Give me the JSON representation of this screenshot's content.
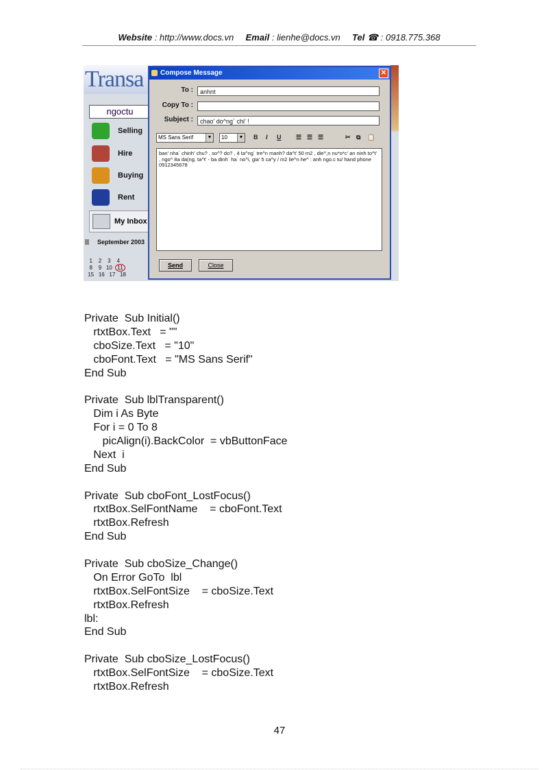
{
  "header": {
    "website_label": "Website",
    "website_value": ": http://www.docs.vn",
    "email_label": "Email",
    "email_value": ": lienhe@docs.vn",
    "tel_label": "Tel",
    "tel_icon": "phone-icon",
    "tel_value": ": 0918.775.368"
  },
  "screenshot": {
    "banner": "Transa",
    "user": "ngoctu",
    "nav": [
      {
        "label": "Selling",
        "icon": "selling-icon",
        "color": "#2fa52f"
      },
      {
        "label": "Hire",
        "icon": "house-icon",
        "color": "#b0463a"
      },
      {
        "label": "Buying",
        "icon": "people-icon",
        "color": "#d9901c"
      },
      {
        "label": "Rent",
        "icon": "book-icon",
        "color": "#1f3d9a"
      }
    ],
    "inbox_label": "My Inbox",
    "month": "September 2003",
    "calendar": [
      [
        "1",
        "2",
        "3",
        "4"
      ],
      [
        "8",
        "9",
        "10",
        "11"
      ],
      [
        "15",
        "16",
        "17",
        "18"
      ]
    ],
    "dialog": {
      "title": "Compose Message",
      "to_label": "To :",
      "to_value": "anhnt",
      "copy_label": "Copy To :",
      "copy_value": "",
      "subject_label": "Subject :",
      "subject_value": "chao' do^ng` chi' !",
      "font_value": "MS Sans Serif",
      "size_value": "10",
      "bold": "B",
      "italic": "I",
      "underline": "U",
      "body_text": "ban' nha` chinh' chu? , so^? do? , 4 ta^ng` tre^n manh? da^t' 50 m2 , die^,n nu*o*c' an ninh to^t' , ngo^ 8a da(ng. ta^t' - ba dinh` ha` no^i, gia' 5 ca^y / m2 lie^n he^ : anh ngo.c tu/ hand phone 0912345678",
      "send": "Send",
      "close": "Close"
    }
  },
  "code_lines": [
    "Private  Sub Initial()",
    "   rtxtBox.Text   = \"\"",
    "   cboSize.Text   = \"10\"",
    "   cboFont.Text   = \"MS Sans Serif\"",
    "End Sub",
    "",
    "Private  Sub lblTransparent()",
    "   Dim i As Byte",
    "   For i = 0 To 8",
    "      picAlign(i).BackColor  = vbButtonFace",
    "   Next  i",
    "End Sub",
    "",
    "Private  Sub cboFont_LostFocus()",
    "   rtxtBox.SelFontName    = cboFont.Text",
    "   rtxtBox.Refresh",
    "End Sub",
    "",
    "Private  Sub cboSize_Change()",
    "   On Error GoTo  lbl",
    "   rtxtBox.SelFontSize    = cboSize.Text",
    "   rtxtBox.Refresh",
    "lbl:",
    "End Sub",
    "",
    "Private  Sub cboSize_LostFocus()",
    "   rtxtBox.SelFontSize    = cboSize.Text",
    "   rtxtBox.Refresh"
  ],
  "page_number": "47"
}
